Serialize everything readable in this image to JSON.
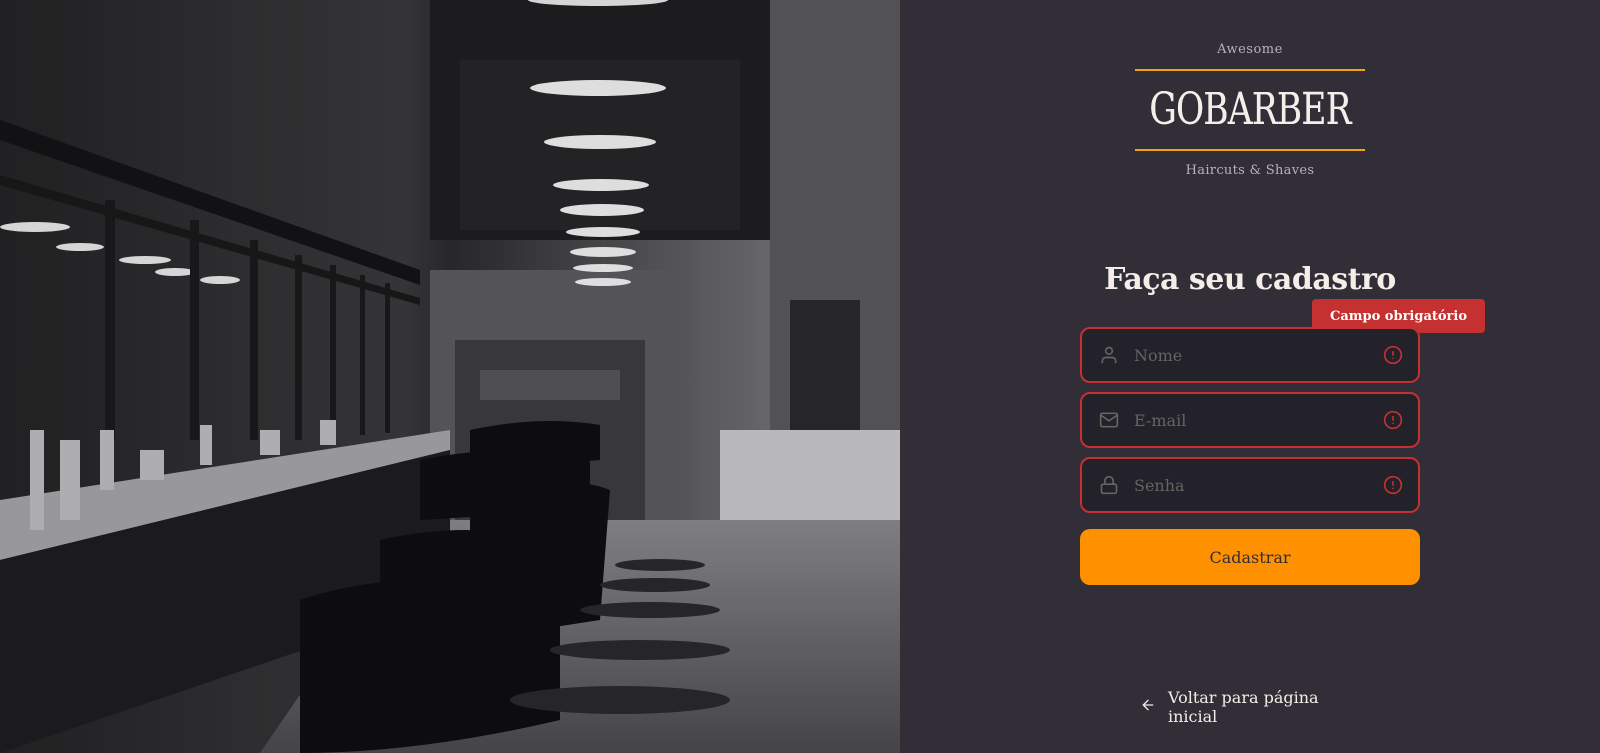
{
  "brand": {
    "top": "Awesome",
    "name": "GOBARBER",
    "sub": "Haircuts & Shaves",
    "accent": "#f3a018"
  },
  "form": {
    "title": "Faça seu cadastro",
    "error_tooltip": "Campo obrigatório",
    "fields": {
      "name": {
        "placeholder": "Nome",
        "icon": "user-icon"
      },
      "email": {
        "placeholder": "E-mail",
        "icon": "mail-icon"
      },
      "password": {
        "placeholder": "Senha",
        "icon": "lock-icon"
      }
    },
    "submit_label": "Cadastrar"
  },
  "back_link": {
    "label": "Voltar para página inicial",
    "icon": "arrow-left-icon"
  },
  "colors": {
    "background": "#312e38",
    "input_bg": "#232129",
    "error": "#c53030",
    "button": "#ff9000",
    "text": "#f4ede8",
    "placeholder": "#666360"
  }
}
